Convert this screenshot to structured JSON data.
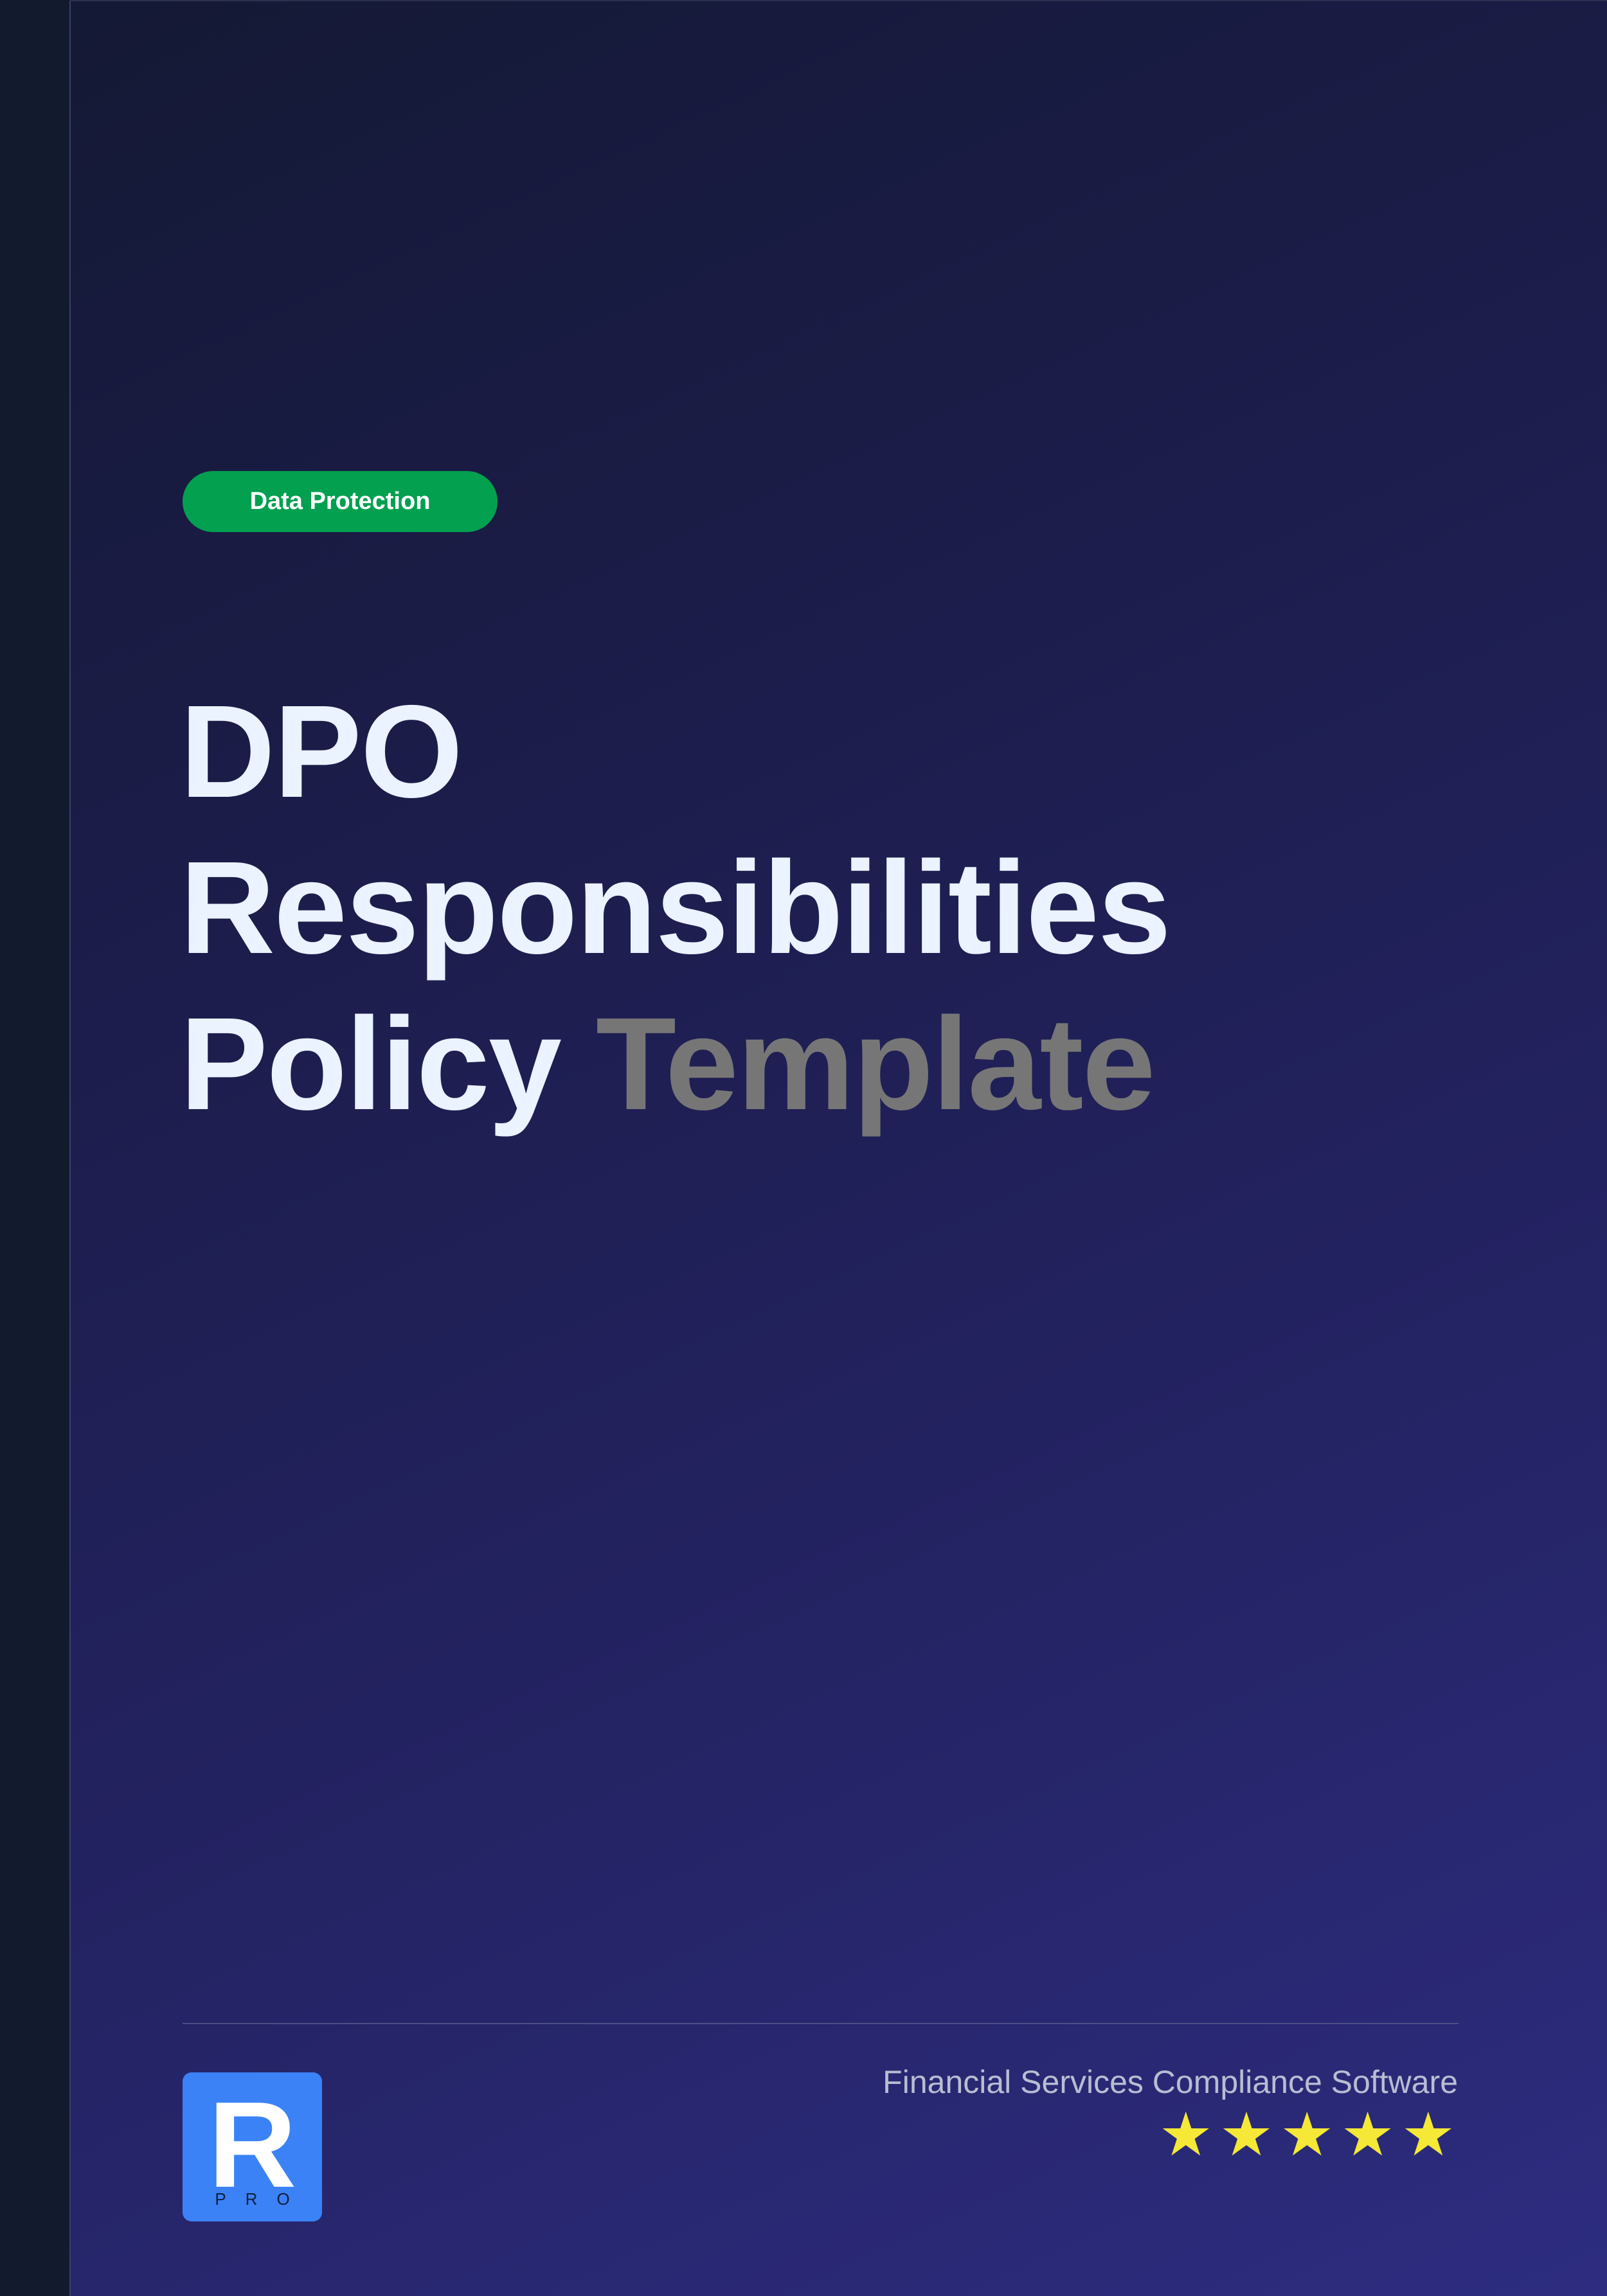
{
  "badge": {
    "label": "Data Protection",
    "color": "#03a050"
  },
  "title": {
    "line1": "DPO",
    "line2": "Responsibilities",
    "line3_main": "Policy",
    "line3_accent": "Template"
  },
  "footer": {
    "tagline": "Financial Services Compliance Software",
    "rating": 5,
    "star_glyph": "★",
    "logo": {
      "letter": "R",
      "subtext": "PRO",
      "color": "#3b82f6"
    }
  },
  "colors": {
    "title": "#eaf3ff",
    "title_accent": "#767676",
    "stars": "#f5e836"
  }
}
